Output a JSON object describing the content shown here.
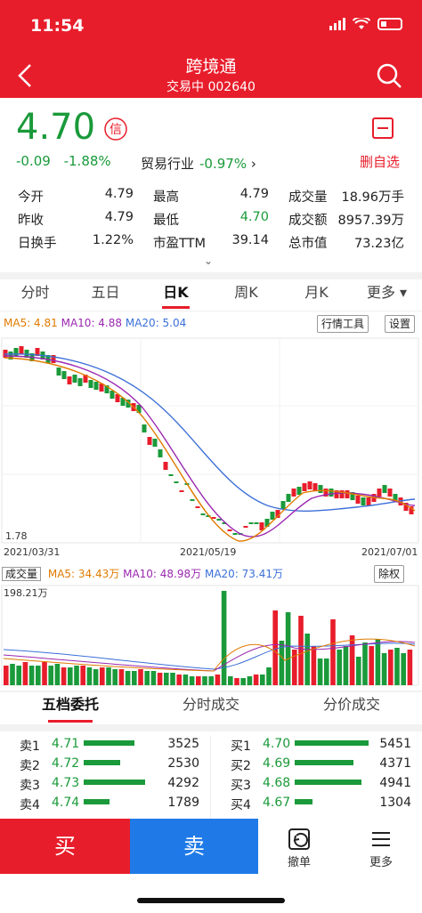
{
  "status": {
    "time": "11:54"
  },
  "nav": {
    "title": "跨境通",
    "subtitle": "交易中 002640"
  },
  "quote": {
    "price": "4.70",
    "change": "-0.09",
    "change_pct": "-1.88%",
    "industry_label": "贸易行业",
    "industry_pct": "-0.97%",
    "industry_arrow": "›",
    "remove_fav": "删自选",
    "trust_badge": "信"
  },
  "stats": [
    [
      {
        "l": "今开",
        "v": "4.79"
      },
      {
        "l": "最高",
        "v": "4.79"
      },
      {
        "l": "成交量",
        "v": "18.96万手"
      }
    ],
    [
      {
        "l": "昨收",
        "v": "4.79"
      },
      {
        "l": "最低",
        "v": "4.70"
      },
      {
        "l": "成交额",
        "v": "8957.39万"
      }
    ],
    [
      {
        "l": "日换手",
        "v": "1.22%"
      },
      {
        "l": "市盈TTM",
        "v": "39.14"
      },
      {
        "l": "总市值",
        "v": "73.23亿"
      }
    ]
  ],
  "tabs": [
    "分时",
    "五日",
    "日K",
    "周K",
    "月K",
    "更多 ▾"
  ],
  "ma": {
    "ma5": "MA5: 4.81",
    "ma10": "MA10: 4.88",
    "ma20": "MA20: 5.04"
  },
  "tools": {
    "market_tools": "行情工具",
    "settings": "设置"
  },
  "chart_data": {
    "type": "candlestick",
    "x_labels": [
      "2021/03/31",
      "2021/05/19",
      "2021/07/01"
    ],
    "low_label": "1.78",
    "series": [
      {
        "name": "MA5"
      },
      {
        "name": "MA10"
      },
      {
        "name": "MA20"
      }
    ]
  },
  "volume": {
    "selector": "成交量",
    "ma5": "MA5: 34.43万",
    "ma10": "MA10: 48.98万",
    "ma20": "MA20: 73.41万",
    "max_label": "198.21万",
    "adjust": "除权"
  },
  "orderbook": {
    "tabs": [
      "五档委托",
      "分时成交",
      "分价成交"
    ],
    "sell": [
      {
        "lbl": "卖1",
        "price": "4.71",
        "vol": "3525",
        "bar": 0.62
      },
      {
        "lbl": "卖2",
        "price": "4.72",
        "vol": "2530",
        "bar": 0.45
      },
      {
        "lbl": "卖3",
        "price": "4.73",
        "vol": "4292",
        "bar": 0.75
      },
      {
        "lbl": "卖4",
        "price": "4.74",
        "vol": "1789",
        "bar": 0.32
      }
    ],
    "buy": [
      {
        "lbl": "买1",
        "price": "4.70",
        "vol": "5451",
        "bar": 0.9
      },
      {
        "lbl": "买2",
        "price": "4.69",
        "vol": "4371",
        "bar": 0.72
      },
      {
        "lbl": "买3",
        "price": "4.68",
        "vol": "4941",
        "bar": 0.82
      },
      {
        "lbl": "买4",
        "price": "4.67",
        "vol": "1304",
        "bar": 0.22
      }
    ]
  },
  "bottom": {
    "buy": "买",
    "sell": "卖",
    "cancel": "撤单",
    "more": "更多"
  }
}
